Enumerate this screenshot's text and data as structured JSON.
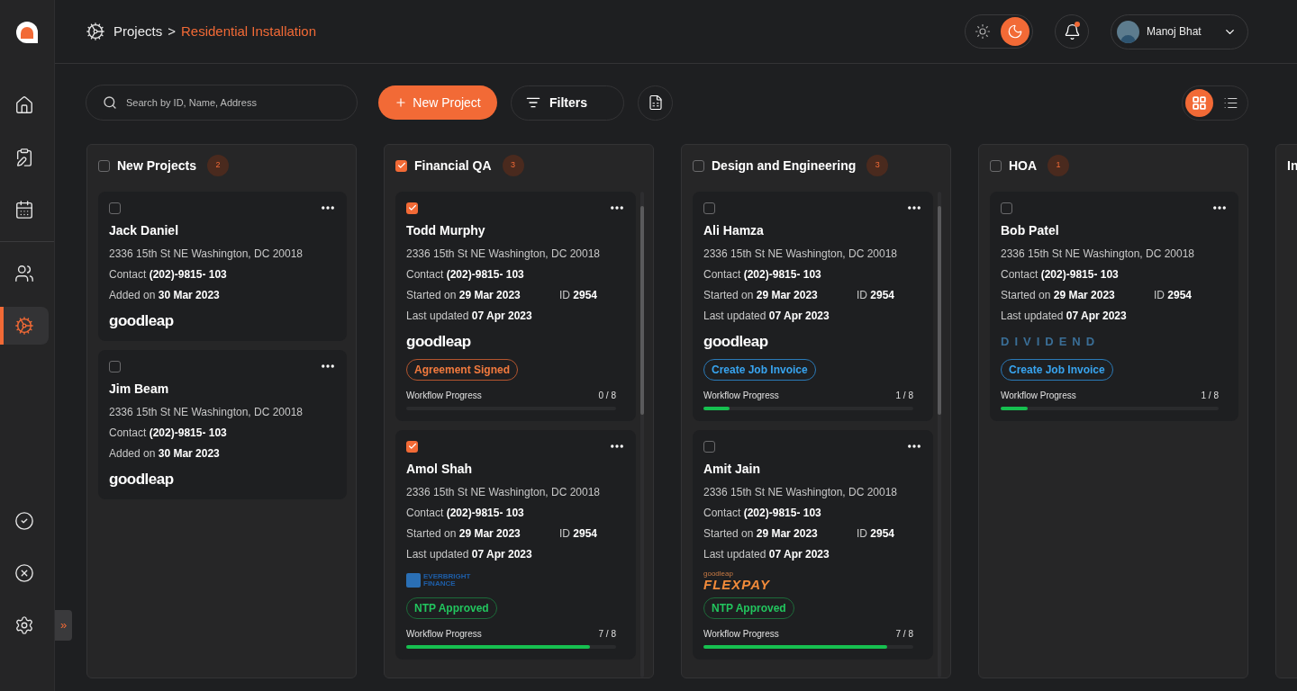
{
  "sidebar": {
    "items": [
      {
        "kind": "home",
        "selected": false
      },
      {
        "kind": "clipboard",
        "selected": false
      },
      {
        "kind": "calendar",
        "selected": false
      },
      {
        "kind": "users",
        "selected": false
      },
      {
        "kind": "projects",
        "selected": true
      }
    ],
    "bottom_items": [
      {
        "kind": "check"
      },
      {
        "kind": "cancel"
      },
      {
        "kind": "settings"
      }
    ],
    "expand": "»"
  },
  "breadcrumb": {
    "items": [
      {
        "label": "Projects",
        "current": false
      },
      {
        "label": "Residential Installation",
        "current": true
      }
    ],
    "separator": ">"
  },
  "theme_toggle": [
    {
      "kind": "light",
      "selected": false
    },
    {
      "kind": "dark",
      "selected": true
    }
  ],
  "notifications": {
    "unread": true
  },
  "user": {
    "name": "Manoj Bhat"
  },
  "toolbar": {
    "search": {
      "placeholder": "Search by ID, Name, Address"
    },
    "new_project": "New Project",
    "filters": "Filters"
  },
  "view_toggle": [
    {
      "kind": "grid",
      "selected": true
    },
    {
      "kind": "list",
      "selected": false
    }
  ],
  "columns": [
    {
      "title": "New Projects",
      "count": "2",
      "checked": false,
      "scrollbar": false,
      "cards": [
        {
          "checked": false,
          "name": "Jack Daniel",
          "address": "2336 15th St NE Washington, DC 20018",
          "rows": [
            [
              "Contact **(202)-9815- 103**"
            ],
            [
              "Added on **30 Mar 2023**"
            ]
          ],
          "lender": {
            "kind": "goodleap",
            "lines": [
              "goodleap"
            ]
          }
        },
        {
          "checked": false,
          "name": "Jim Beam",
          "address": "2336 15th St NE Washington, DC 20018",
          "rows": [
            [
              "Contact **(202)-9815- 103**"
            ],
            [
              "Added on **30 Mar 2023**"
            ]
          ],
          "lender": {
            "kind": "goodleap",
            "lines": [
              "goodleap"
            ]
          }
        }
      ]
    },
    {
      "title": "Financial QA",
      "count": "3",
      "checked": true,
      "scrollbar": true,
      "cards": [
        {
          "checked": true,
          "name": "Todd Murphy",
          "address": "2336 15th St NE Washington, DC 20018",
          "rows": [
            [
              "Contact **(202)-9815- 103**"
            ],
            [
              "Started on **29 Mar 2023**",
              "ID **2954**"
            ],
            [
              "Last updated **07 Apr 2023**"
            ]
          ],
          "lender": {
            "kind": "goodleap",
            "lines": [
              "goodleap"
            ]
          },
          "badge": {
            "kind": "agreement",
            "label": "Agreement Signed"
          },
          "progress": {
            "label": "Workflow Progress",
            "reading": "0 / 8",
            "level": 0
          }
        },
        {
          "checked": true,
          "name": "Amol Shah",
          "address": "2336 15th St NE Washington, DC 20018",
          "rows": [
            [
              "Contact **(202)-9815- 103**"
            ],
            [
              "Started on **29 Mar 2023**",
              "ID **2954**"
            ],
            [
              "Last updated **07 Apr 2023**"
            ]
          ],
          "lender": {
            "kind": "everbright",
            "lines": [
              "EVERBRIGHT",
              "FINANCE"
            ]
          },
          "badge": {
            "kind": "ntp",
            "label": "NTP Approved"
          },
          "progress": {
            "label": "Workflow Progress",
            "reading": "7 / 8",
            "level": 0.875
          }
        }
      ]
    },
    {
      "title": "Design and Engineering",
      "count": "3",
      "checked": false,
      "scrollbar": true,
      "cards": [
        {
          "checked": false,
          "name": "Ali Hamza",
          "address": "2336 15th St NE Washington, DC 20018",
          "rows": [
            [
              "Contact **(202)-9815- 103**"
            ],
            [
              "Started on **29 Mar 2023**",
              "ID **2954**"
            ],
            [
              "Last updated **07 Apr 2023**"
            ]
          ],
          "lender": {
            "kind": "goodleap",
            "lines": [
              "goodleap"
            ]
          },
          "badge": {
            "kind": "invoice",
            "label": "Create Job Invoice"
          },
          "progress": {
            "label": "Workflow Progress",
            "reading": "1 / 8",
            "level": 0.125
          }
        },
        {
          "checked": false,
          "name": "Amit Jain",
          "address": "2336 15th St NE Washington, DC 20018",
          "rows": [
            [
              "Contact **(202)-9815- 103**"
            ],
            [
              "Started on **29 Mar 2023**",
              "ID **2954**"
            ],
            [
              "Last updated **07 Apr 2023**"
            ]
          ],
          "lender": {
            "kind": "flexpay",
            "lines": [
              "goodleap",
              "FLEXPAY"
            ]
          },
          "badge": {
            "kind": "ntp",
            "label": "NTP Approved"
          },
          "progress": {
            "label": "Workflow Progress",
            "reading": "7 / 8",
            "level": 0.875
          }
        }
      ]
    },
    {
      "title": "HOA",
      "count": "1",
      "checked": false,
      "scrollbar": false,
      "cards": [
        {
          "checked": false,
          "name": "Bob Patel",
          "address": "2336 15th St NE Washington, DC 20018",
          "rows": [
            [
              "Contact **(202)-9815- 103**"
            ],
            [
              "Started on **29 Mar 2023**",
              "ID **2954**"
            ],
            [
              "Last updated **07 Apr 2023**"
            ]
          ],
          "lender": {
            "kind": "dividend",
            "lines": [
              "DIVIDEND"
            ]
          },
          "badge": {
            "kind": "invoice",
            "label": "Create Job Invoice"
          },
          "progress": {
            "label": "Workflow Progress",
            "reading": "1 / 8",
            "level": 0.125
          }
        }
      ]
    },
    {
      "title": "In"
    }
  ]
}
